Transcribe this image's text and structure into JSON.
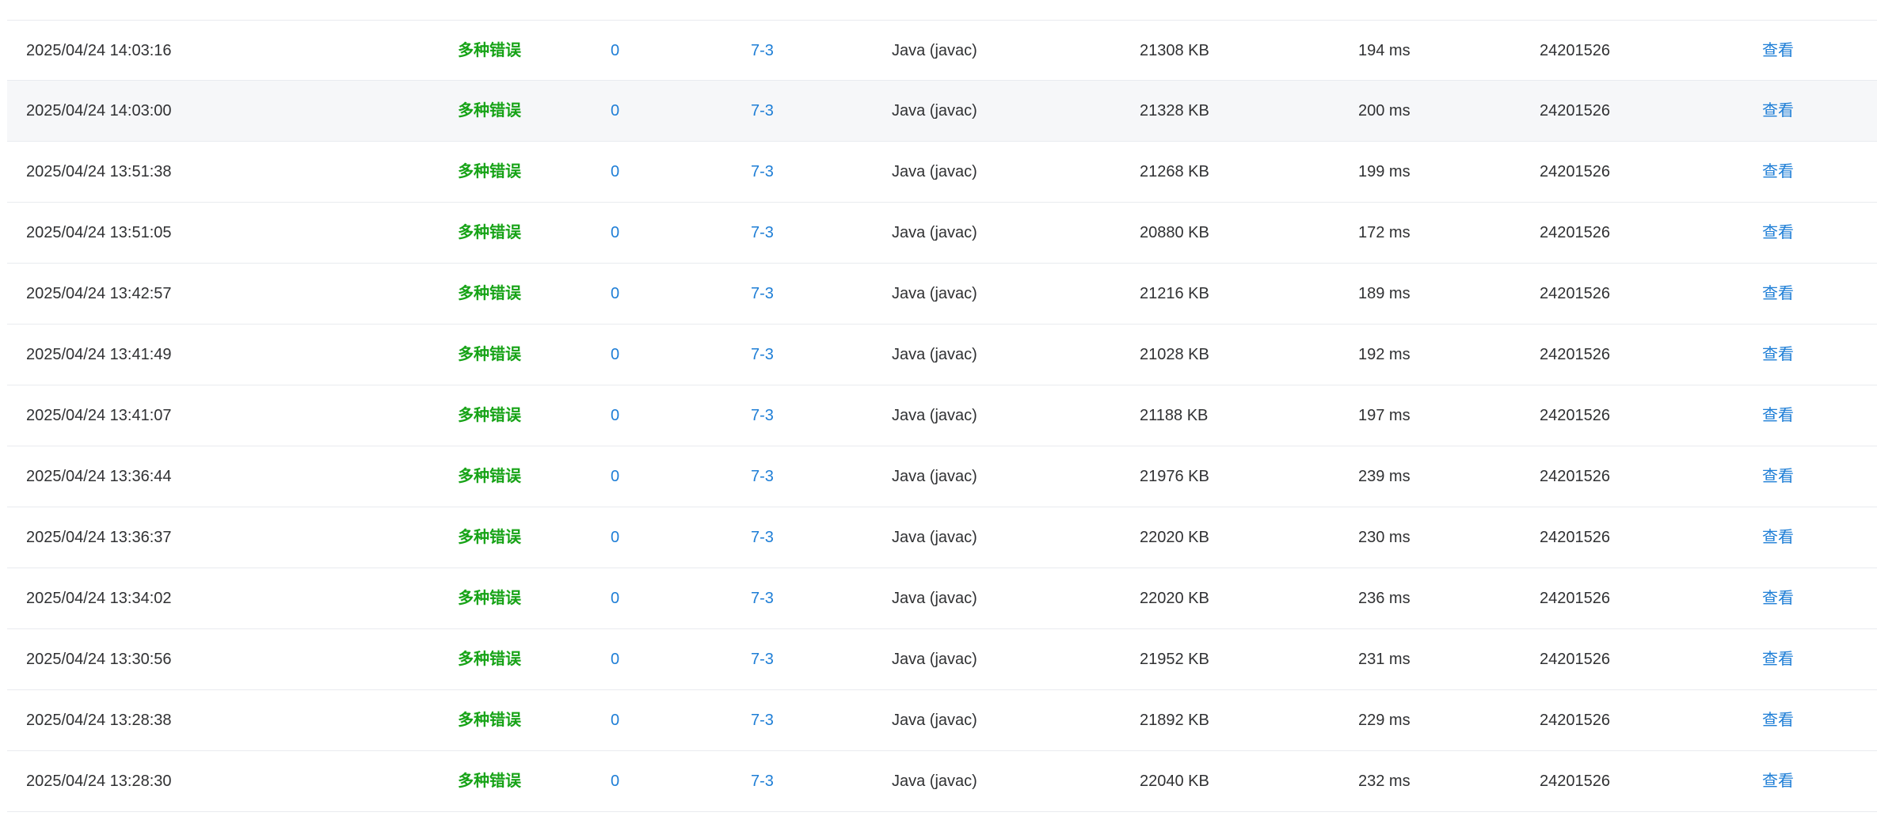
{
  "submissions": [
    {
      "time": "2025/04/24 14:03:16",
      "status": "多种错误",
      "score": "0",
      "problem": "7-3",
      "language": "Java (javac)",
      "memory": "21308 KB",
      "duration": "194 ms",
      "user": "24201526",
      "action": "查看"
    },
    {
      "time": "2025/04/24 14:03:00",
      "status": "多种错误",
      "score": "0",
      "problem": "7-3",
      "language": "Java (javac)",
      "memory": "21328 KB",
      "duration": "200 ms",
      "user": "24201526",
      "action": "查看"
    },
    {
      "time": "2025/04/24 13:51:38",
      "status": "多种错误",
      "score": "0",
      "problem": "7-3",
      "language": "Java (javac)",
      "memory": "21268 KB",
      "duration": "199 ms",
      "user": "24201526",
      "action": "查看"
    },
    {
      "time": "2025/04/24 13:51:05",
      "status": "多种错误",
      "score": "0",
      "problem": "7-3",
      "language": "Java (javac)",
      "memory": "20880 KB",
      "duration": "172 ms",
      "user": "24201526",
      "action": "查看"
    },
    {
      "time": "2025/04/24 13:42:57",
      "status": "多种错误",
      "score": "0",
      "problem": "7-3",
      "language": "Java (javac)",
      "memory": "21216 KB",
      "duration": "189 ms",
      "user": "24201526",
      "action": "查看"
    },
    {
      "time": "2025/04/24 13:41:49",
      "status": "多种错误",
      "score": "0",
      "problem": "7-3",
      "language": "Java (javac)",
      "memory": "21028 KB",
      "duration": "192 ms",
      "user": "24201526",
      "action": "查看"
    },
    {
      "time": "2025/04/24 13:41:07",
      "status": "多种错误",
      "score": "0",
      "problem": "7-3",
      "language": "Java (javac)",
      "memory": "21188 KB",
      "duration": "197 ms",
      "user": "24201526",
      "action": "查看"
    },
    {
      "time": "2025/04/24 13:36:44",
      "status": "多种错误",
      "score": "0",
      "problem": "7-3",
      "language": "Java (javac)",
      "memory": "21976 KB",
      "duration": "239 ms",
      "user": "24201526",
      "action": "查看"
    },
    {
      "time": "2025/04/24 13:36:37",
      "status": "多种错误",
      "score": "0",
      "problem": "7-3",
      "language": "Java (javac)",
      "memory": "22020 KB",
      "duration": "230 ms",
      "user": "24201526",
      "action": "查看"
    },
    {
      "time": "2025/04/24 13:34:02",
      "status": "多种错误",
      "score": "0",
      "problem": "7-3",
      "language": "Java (javac)",
      "memory": "22020 KB",
      "duration": "236 ms",
      "user": "24201526",
      "action": "查看"
    },
    {
      "time": "2025/04/24 13:30:56",
      "status": "多种错误",
      "score": "0",
      "problem": "7-3",
      "language": "Java (javac)",
      "memory": "21952 KB",
      "duration": "231 ms",
      "user": "24201526",
      "action": "查看"
    },
    {
      "time": "2025/04/24 13:28:38",
      "status": "多种错误",
      "score": "0",
      "problem": "7-3",
      "language": "Java (javac)",
      "memory": "21892 KB",
      "duration": "229 ms",
      "user": "24201526",
      "action": "查看"
    },
    {
      "time": "2025/04/24 13:28:30",
      "status": "多种错误",
      "score": "0",
      "problem": "7-3",
      "language": "Java (javac)",
      "memory": "22040 KB",
      "duration": "232 ms",
      "user": "24201526",
      "action": "查看"
    }
  ],
  "colors": {
    "status_error": "#17a317",
    "link": "#1e7ed6",
    "text": "#303133",
    "row_highlight": "#f6f7f9",
    "divider": "#e9ebef"
  }
}
